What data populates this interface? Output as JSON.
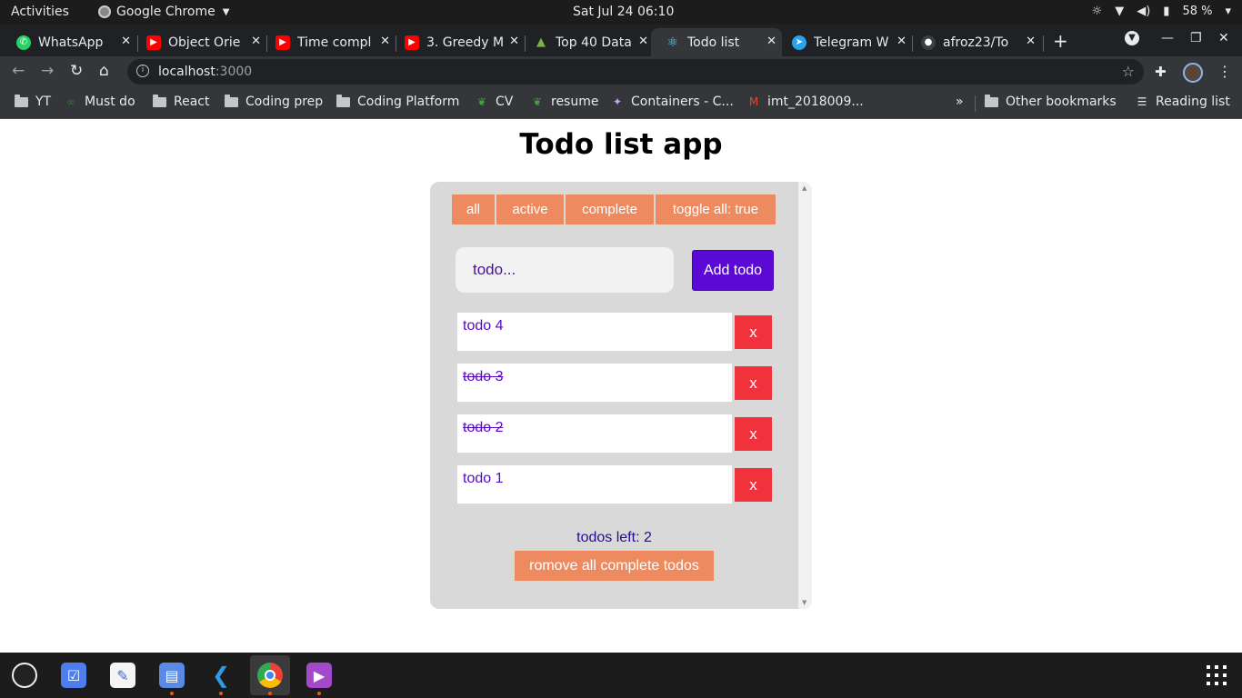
{
  "system_bar": {
    "activities": "Activities",
    "app_name": "Google Chrome",
    "clock": "Sat Jul 24  06:10",
    "battery": "58 %"
  },
  "tabs": [
    {
      "label": "WhatsApp",
      "icon": "whatsapp-icon",
      "color": "#25d366"
    },
    {
      "label": "Object Orie",
      "icon": "youtube-icon",
      "color": "#ff0000"
    },
    {
      "label": "Time compl",
      "icon": "youtube-icon",
      "color": "#ff0000"
    },
    {
      "label": "3. Greedy M",
      "icon": "youtube-icon",
      "color": "#ff0000"
    },
    {
      "label": "Top 40 Data",
      "icon": "mountain-icon",
      "color": "#7cb342"
    },
    {
      "label": "Todo list",
      "icon": "react-icon",
      "color": "#61dafb"
    },
    {
      "label": "Telegram W",
      "icon": "telegram-icon",
      "color": "#2aa3ef"
    },
    {
      "label": "afroz23/To",
      "icon": "github-icon",
      "color": "#8b949e"
    }
  ],
  "omnibox": {
    "host": "localhost",
    "port": ":3000"
  },
  "bookmarks": [
    {
      "label": "YT",
      "icon": "folder-icon"
    },
    {
      "label": "Must do",
      "icon": "infinity-icon"
    },
    {
      "label": "React",
      "icon": "folder-icon"
    },
    {
      "label": "Coding prep",
      "icon": "folder-icon"
    },
    {
      "label": "Coding Platform",
      "icon": "folder-icon"
    },
    {
      "label": "CV",
      "icon": "overleaf-icon"
    },
    {
      "label": "resume",
      "icon": "overleaf-icon"
    },
    {
      "label": "Containers - C...",
      "icon": "containers-icon"
    },
    {
      "label": "imt_2018009...",
      "icon": "gmail-icon"
    }
  ],
  "bookmarks_right": {
    "overflow": "»",
    "other": "Other bookmarks",
    "reading": "Reading list"
  },
  "app": {
    "title": "Todo list app",
    "filters": {
      "all": "all",
      "active": "active",
      "complete": "complete",
      "toggle": "toggle all: true"
    },
    "input_placeholder": "todo...",
    "add_label": "Add todo",
    "todos": [
      {
        "text": "todo 4",
        "complete": false,
        "delete": "x"
      },
      {
        "text": "todo 3",
        "complete": true,
        "delete": "x"
      },
      {
        "text": "todo 2",
        "complete": true,
        "delete": "x"
      },
      {
        "text": "todo 1",
        "complete": false,
        "delete": "x"
      }
    ],
    "todos_left": "todos left: 2",
    "remove_complete": "romove all complete todos"
  },
  "colors": {
    "filter_button": "#ee8a5f",
    "add_button": "#5b0ad6",
    "delete_button": "#f1323d",
    "todo_text": "#5708c4"
  },
  "dock": [
    "obs-icon",
    "tasks-icon",
    "text-editor-icon",
    "files-icon",
    "vscode-icon",
    "chrome-icon",
    "video-icon"
  ]
}
